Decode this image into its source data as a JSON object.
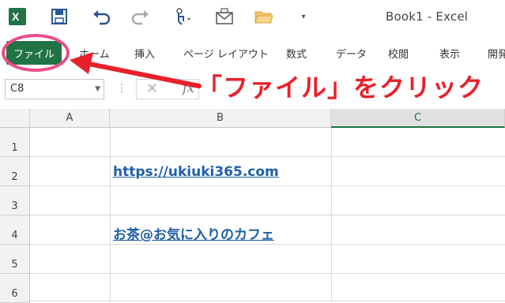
{
  "window": {
    "title": "Book1 - Excel"
  },
  "qat": {
    "undo_icon": "undo-icon",
    "redo_icon": "redo-icon"
  },
  "ribbon": {
    "file_tab": "ファイル",
    "tabs": [
      "ホーム",
      "挿入",
      "ページ レイアウト",
      "数式",
      "データ",
      "校閲",
      "表示",
      "開発"
    ]
  },
  "annotation": {
    "text": "「ファイル」をクリック",
    "color": "#e8202a"
  },
  "formula_bar": {
    "name_box": "C8",
    "fx": "fx"
  },
  "sheet": {
    "columns": [
      "A",
      "B",
      "C"
    ],
    "rows": [
      "1",
      "2",
      "3",
      "4",
      "5",
      "6"
    ],
    "cells": {
      "B2": "https://ukiuki365.com",
      "B4": "お茶@お気に入りのカフェ"
    }
  },
  "colors": {
    "excel_green": "#217346",
    "highlight_pink": "#ec4c8c",
    "arrow_red": "#e8202a",
    "link_blue": "#1f5fa8"
  }
}
